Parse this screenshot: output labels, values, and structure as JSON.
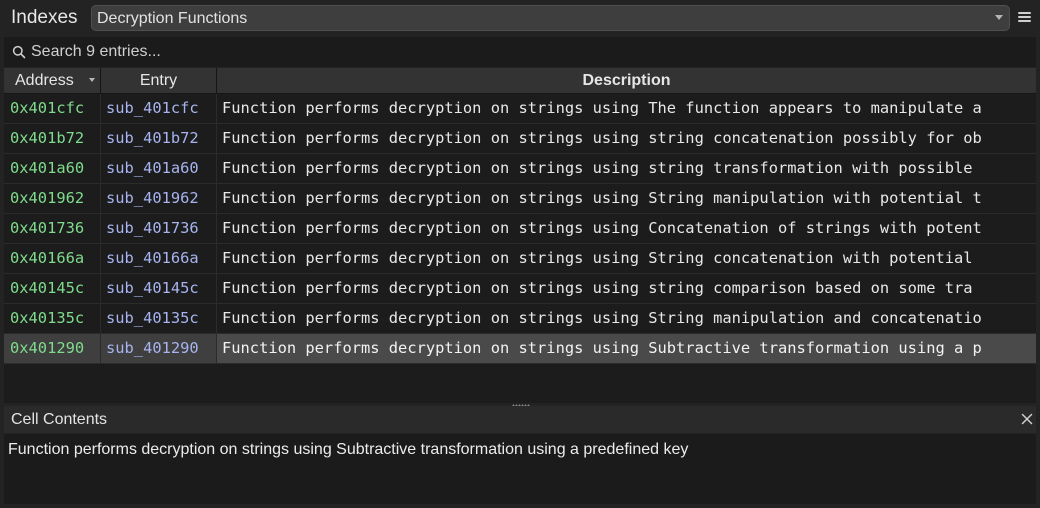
{
  "header": {
    "title": "Indexes",
    "selected_index": "Decryption Functions"
  },
  "search": {
    "placeholder": "Search 9 entries..."
  },
  "table": {
    "columns": {
      "address": "Address",
      "entry": "Entry",
      "description": "Description"
    },
    "rows": [
      {
        "address": "0x401cfc",
        "entry": "sub_401cfc",
        "description": "Function performs decryption on strings using The function appears to manipulate a"
      },
      {
        "address": "0x401b72",
        "entry": "sub_401b72",
        "description": "Function performs decryption on strings using string concatenation possibly for ob"
      },
      {
        "address": "0x401a60",
        "entry": "sub_401a60",
        "description": "Function performs decryption on strings using string transformation with possible"
      },
      {
        "address": "0x401962",
        "entry": "sub_401962",
        "description": "Function performs decryption on strings using String manipulation with potential t"
      },
      {
        "address": "0x401736",
        "entry": "sub_401736",
        "description": "Function performs decryption on strings using Concatenation of strings with potent"
      },
      {
        "address": "0x40166a",
        "entry": "sub_40166a",
        "description": "Function performs decryption on strings using String concatenation with potential"
      },
      {
        "address": "0x40145c",
        "entry": "sub_40145c",
        "description": "Function performs decryption on strings using string comparison based on some tra"
      },
      {
        "address": "0x40135c",
        "entry": "sub_40135c",
        "description": "Function performs decryption on strings using String manipulation and concatenatio"
      },
      {
        "address": "0x401290",
        "entry": "sub_401290",
        "description": "Function performs decryption on strings using Subtractive transformation using a p",
        "selected": true
      }
    ]
  },
  "cell_contents": {
    "title": "Cell Contents",
    "text": "Function performs decryption on strings using Subtractive transformation using a predefined key"
  },
  "icons": {
    "menu": "hamburger-menu-icon",
    "search": "search-icon",
    "close": "close-icon",
    "sort": "sort-descending-icon",
    "dropdown": "chevron-down-icon"
  },
  "colors": {
    "address": "#7fdc8c",
    "entry": "#a7b4ef",
    "selected_row": "#4a4a4a"
  }
}
